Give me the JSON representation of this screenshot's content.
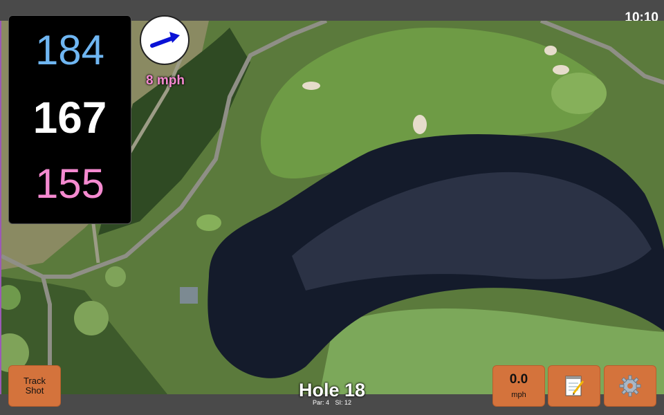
{
  "status_bar": {
    "time": "10:10"
  },
  "distances": {
    "back": "184",
    "middle": "167",
    "front": "155"
  },
  "wind": {
    "speed": "8 mph",
    "icon": "wind-direction-arrow-icon"
  },
  "hole": {
    "title": "Hole 18",
    "par_label": "Par: 4",
    "si_label": "SI: 12"
  },
  "buttons": {
    "track_shot": "Track Shot",
    "speed_value": "0.0",
    "speed_unit": "mph",
    "notes_icon": "notepad-icon",
    "settings_icon": "gear-icon"
  },
  "colors": {
    "back": "#6fb6f2",
    "middle": "#ffffff",
    "front": "#f58ad0",
    "button": "#d4733c"
  }
}
